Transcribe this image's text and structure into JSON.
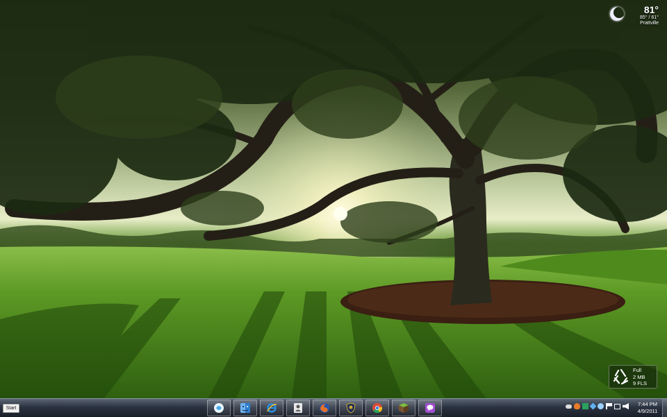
{
  "weather": {
    "temperature": "81°",
    "range": "85° / 61°",
    "city": "Prattville",
    "icon": "moon-icon"
  },
  "recycle_bin": {
    "icon": "recycle-icon",
    "status": "Full",
    "size": "2 MB",
    "files": "9 FLS"
  },
  "taskbar": {
    "start_label": "Start",
    "apps": [
      {
        "name": "orb-app",
        "icon": "swirl-icon",
        "color": "#8fd0ff"
      },
      {
        "name": "finder",
        "icon": "finder-icon",
        "color": "#5aa0e6"
      },
      {
        "name": "internet-explorer",
        "icon": "ie-icon",
        "color": "#2a8fe0"
      },
      {
        "name": "contacts",
        "icon": "contacts-icon",
        "color": "#d8d8d8"
      },
      {
        "name": "firefox",
        "icon": "firefox-icon",
        "color": "#e8702a"
      },
      {
        "name": "shield-app",
        "icon": "shield-icon",
        "color": "#c9a53a"
      },
      {
        "name": "chrome",
        "icon": "chrome-icon",
        "color": "#de4b39"
      },
      {
        "name": "minecraft",
        "icon": "cube-icon",
        "color": "#6f9a3a"
      },
      {
        "name": "chat-app",
        "icon": "chat-icon",
        "color": "#a04fd0"
      }
    ],
    "clock": {
      "time": "7:44 PM",
      "date": "4/9/2011"
    }
  }
}
